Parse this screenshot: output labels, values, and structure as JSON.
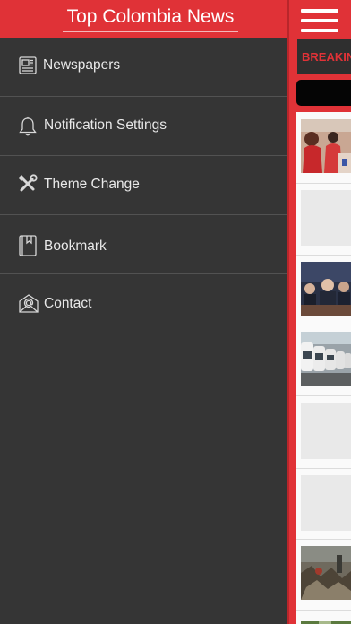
{
  "drawer": {
    "title": "Top Colombia News",
    "items": [
      {
        "label": "Newspapers",
        "icon": "newspaper-icon"
      },
      {
        "label": "Notification Settings",
        "icon": "bell-icon"
      },
      {
        "label": "Theme Change",
        "icon": "tools-icon"
      },
      {
        "label": "Bookmark",
        "icon": "bookmark-icon"
      },
      {
        "label": "Contact",
        "icon": "envelope-at-icon"
      }
    ]
  },
  "main": {
    "menu_icon": "hamburger-icon",
    "breaking_label": "BREAKING"
  },
  "colors": {
    "accent": "#e03237",
    "drawer_bg": "#353535",
    "text": "#e9e9e9"
  }
}
